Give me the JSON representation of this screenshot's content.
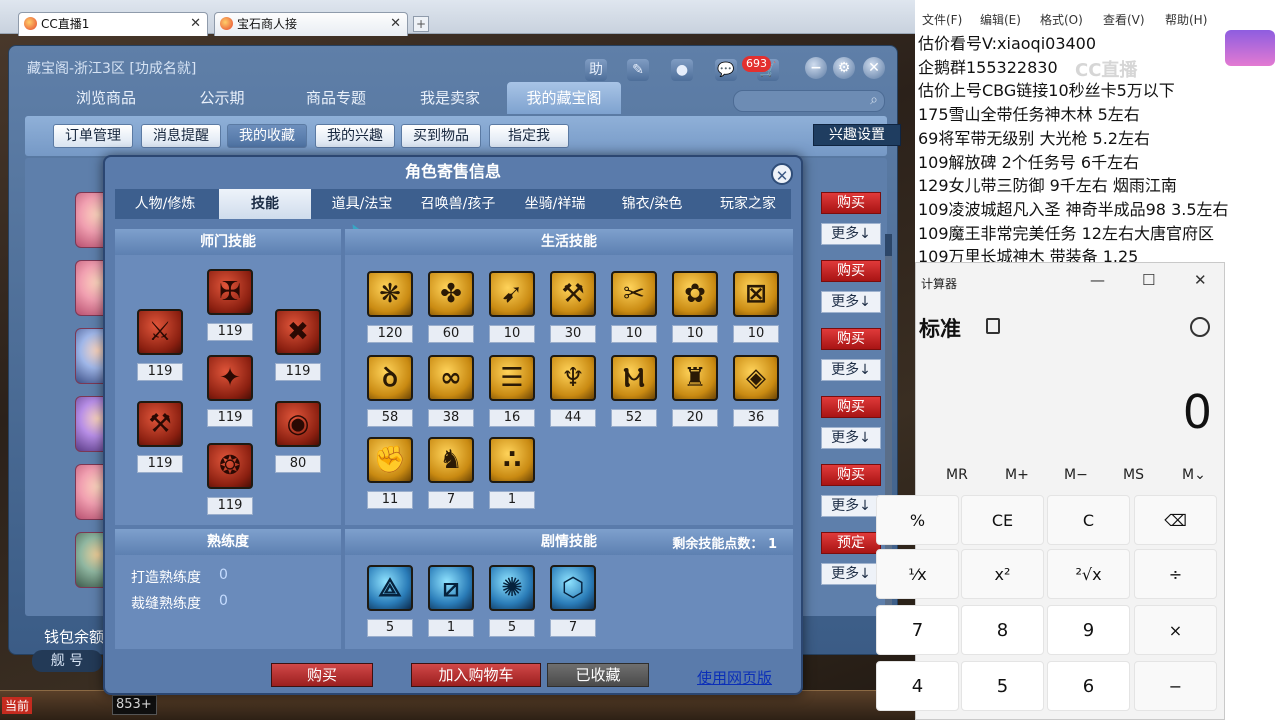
{
  "browser": {
    "tabs": [
      {
        "title": "CC直播1",
        "close": "✕"
      },
      {
        "title": "宝石商人接",
        "close": "✕"
      }
    ],
    "new_tab": "+"
  },
  "main_window": {
    "title": "藏宝阁-浙江3区 [功成名就]",
    "title_icons": [
      "助",
      "✎",
      "●",
      "💬",
      "🛒"
    ],
    "cart_badge": "693",
    "window_buttons": [
      "−",
      "⚙",
      "✕"
    ],
    "tabs": [
      "浏览商品",
      "公示期",
      "商品专题",
      "我是卖家",
      "我的藏宝阁"
    ],
    "search_icon": "⌕",
    "subtabs": [
      "订单管理",
      "消息提醒",
      "我的收藏",
      "我的兴趣",
      "买到物品",
      "指定我"
    ],
    "interest_settings": "兴趣设置",
    "list_actions": [
      {
        "primary": "购买",
        "more": "更多↓"
      },
      {
        "primary": "购买",
        "more": "更多↓"
      },
      {
        "primary": "购买",
        "more": "更多↓"
      },
      {
        "primary": "购买",
        "more": "更多↓"
      },
      {
        "primary": "购买",
        "more": "更多↓"
      },
      {
        "primary": "预定",
        "more": "更多↓"
      }
    ],
    "wallet_label": "钱包余额",
    "ship_label": "舰 号"
  },
  "bottom_strip": {
    "label": "当前",
    "input_value": "853+"
  },
  "modal": {
    "title": "角色寄售信息",
    "close": "✕",
    "tabs": [
      "人物/修炼",
      "技能",
      "道具/法宝",
      "召唤兽/孩子",
      "坐骑/祥瑞",
      "锦衣/染色",
      "玩家之家"
    ],
    "school_skills_title": "师门技能",
    "school_skills": [
      {
        "icon": "school-skill-1-icon",
        "level": "119"
      },
      {
        "icon": "school-skill-2-icon",
        "level": "119"
      },
      {
        "icon": "school-skill-3-icon",
        "level": "119"
      },
      {
        "icon": "school-skill-4-icon",
        "level": "119"
      },
      {
        "icon": "school-skill-5-icon",
        "level": "119"
      },
      {
        "icon": "school-skill-6-icon",
        "level": "80"
      },
      {
        "icon": "school-skill-7-icon",
        "level": "119"
      }
    ],
    "life_skills_title": "生活技能",
    "life_skills": [
      "120",
      "60",
      "10",
      "30",
      "10",
      "10",
      "10",
      "58",
      "38",
      "16",
      "44",
      "52",
      "20",
      "36",
      "11",
      "7",
      "1"
    ],
    "proficiency_title": "熟练度",
    "proficiency": [
      {
        "label": "打造熟练度",
        "value": "0"
      },
      {
        "label": "裁缝熟练度",
        "value": "0"
      }
    ],
    "story_skills_title": "剧情技能",
    "remaining_points": "剩余技能点数： 1",
    "story_skills": [
      "5",
      "1",
      "5",
      "7"
    ],
    "buttons": {
      "buy": "购买",
      "add_cart": "加入购物车",
      "favorited": "已收藏",
      "web": "使用网页版"
    }
  },
  "notepad": {
    "menu": [
      "文件(F)",
      "编辑(E)",
      "格式(O)",
      "查看(V)",
      "帮助(H)"
    ],
    "lines": [
      "估价看号V:xiaoqi03400",
      "企鹅群155322830",
      "估价上号CBG链接10秒丝卡5万以下",
      "175雪山全带任务神木林 5左右",
      "69将军带无级别 大光枪 5.2左右",
      "109解放碑 2个任务号 6千左右",
      "129女儿带三防御 9千左右 烟雨江南",
      "109凌波城超凡入圣 神奇半成品98 3.5左右",
      "109魔王非常完美任务 12左右大唐官府区",
      "109万里长城神木 带装备 1.25"
    ],
    "watermark": "CC直播"
  },
  "calculator": {
    "title": "计算器",
    "controls": [
      "—",
      "☐",
      "✕"
    ],
    "mode": "标准",
    "display": "0",
    "memory": [
      "MR",
      "M+",
      "M−",
      "MS",
      "M⌄"
    ],
    "rows": [
      [
        "%",
        "CE",
        "C",
        "⌫"
      ],
      [
        "⅟x",
        "x²",
        "²√x",
        "÷"
      ],
      [
        "7",
        "8",
        "9",
        "×"
      ],
      [
        "4",
        "5",
        "6",
        "−"
      ]
    ]
  },
  "colors": {
    "accent_red": "#c42b1f",
    "panel_blue": "#5a7bab",
    "link_blue": "#0b2fb8"
  }
}
